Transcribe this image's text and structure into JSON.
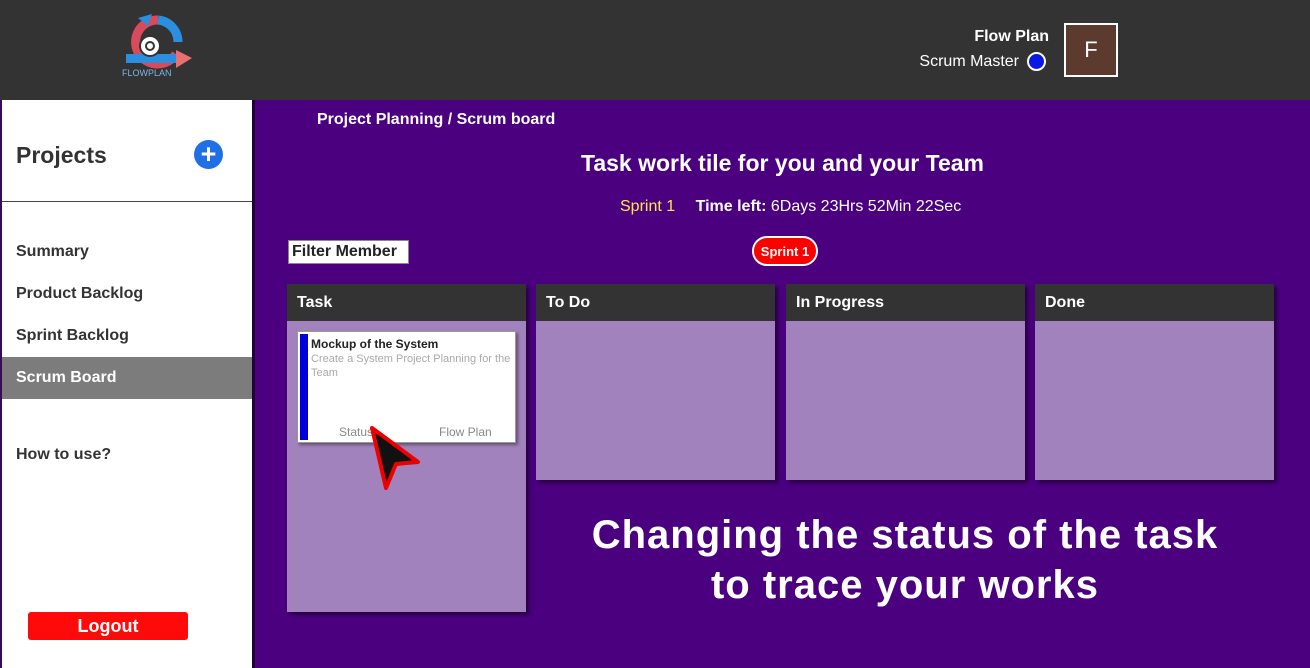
{
  "header": {
    "logo_text": "FLOWPLAN",
    "user_name": "Flow Plan",
    "user_role": "Scrum Master",
    "avatar_initial": "F"
  },
  "sidebar": {
    "projects_title": "Projects",
    "add_label": "+",
    "items": [
      {
        "label": "Summary",
        "active": false
      },
      {
        "label": "Product Backlog",
        "active": false
      },
      {
        "label": "Sprint Backlog",
        "active": false
      },
      {
        "label": "Scrum Board",
        "active": true
      }
    ],
    "how_to": "How to use?",
    "logout": "Logout"
  },
  "main": {
    "breadcrumb": "Project Planning / Scrum board",
    "title": "Task work tile for you and your Team",
    "sprint_name": "Sprint 1",
    "time_left_label": "Time left:",
    "time_left_value": "6Days 23Hrs 52Min 22Sec",
    "filter_label": "Filter Member",
    "sprint_badge": "Sprint 1",
    "columns": [
      "Task",
      "To Do",
      "In Progress",
      "Done"
    ],
    "task": {
      "title": "Mockup of the System",
      "description": "Create a System Project Planning for the Team",
      "status": "Status",
      "owner": "Flow Plan"
    },
    "caption_line1": "Changing the status of the task",
    "caption_line2": "to trace your works"
  },
  "colors": {
    "main_bg": "#4b0080",
    "column_body": "#a282bc",
    "header_bg": "#333333",
    "logout_red": "#ff0a0a",
    "sprint_yellow": "#ffe84a",
    "task_bar_blue": "#0000dd"
  }
}
